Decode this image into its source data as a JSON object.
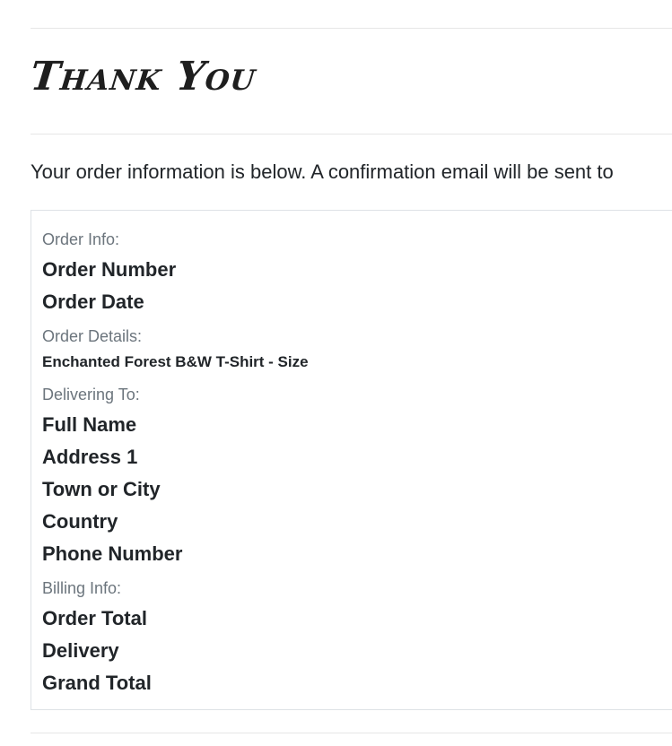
{
  "page": {
    "title": "Thank You",
    "intro": "Your order information is below. A confirmation email will be sent to"
  },
  "order_info": {
    "label": "Order Info:",
    "order_number": "Order Number",
    "order_date": "Order Date"
  },
  "order_details": {
    "label": "Order Details:",
    "item": "Enchanted Forest B&W T-Shirt - Size"
  },
  "delivering_to": {
    "label": "Delivering To:",
    "full_name": "Full Name",
    "address_1": "Address 1",
    "town_or_city": "Town or City",
    "country": "Country",
    "phone_number": "Phone Number"
  },
  "billing_info": {
    "label": "Billing Info:",
    "order_total": "Order Total",
    "delivery": "Delivery",
    "grand_total": "Grand Total"
  },
  "colors": {
    "text": "#212529",
    "muted_label": "#6c757d",
    "border": "#dee2e6",
    "divider": "#e6e6e6"
  }
}
